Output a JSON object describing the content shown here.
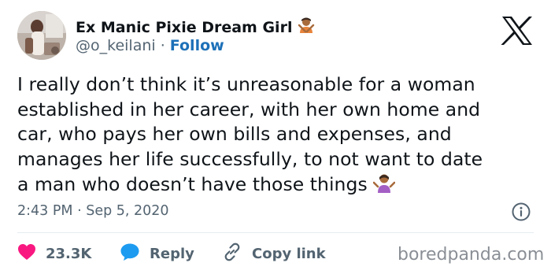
{
  "author": {
    "display_name": "Ex Manic Pixie Dream Girl",
    "name_emoji_icon": "person-gesturing-no-icon",
    "handle": "@o_keilani",
    "separator": " · ",
    "follow_label": "Follow"
  },
  "platform_icon": "x-logo-icon",
  "tweet": {
    "text": "I really don’t think it’s unreasonable for a woman\nestablished in her career, with her own home and\ncar, who pays her own bills and expenses, and\nmanages her life successfully,  to not want to date\na man who doesn’t have those things",
    "trailing_emoji_icon": "person-shrugging-icon"
  },
  "timestamp": {
    "time": "2:43 PM",
    "separator": " · ",
    "date": "Sep 5, 2020"
  },
  "info_icon": "info-icon",
  "actions": {
    "like_count": "23.3K",
    "reply_label": "Reply",
    "copy_link_label": "Copy link"
  },
  "watermark": "boredpanda.com",
  "colors": {
    "like_red": "#f91880",
    "reply_blue": "#1d9bf0",
    "follow_blue": "#1d70b8",
    "muted_gray": "#536471",
    "text": "#0f1419"
  }
}
